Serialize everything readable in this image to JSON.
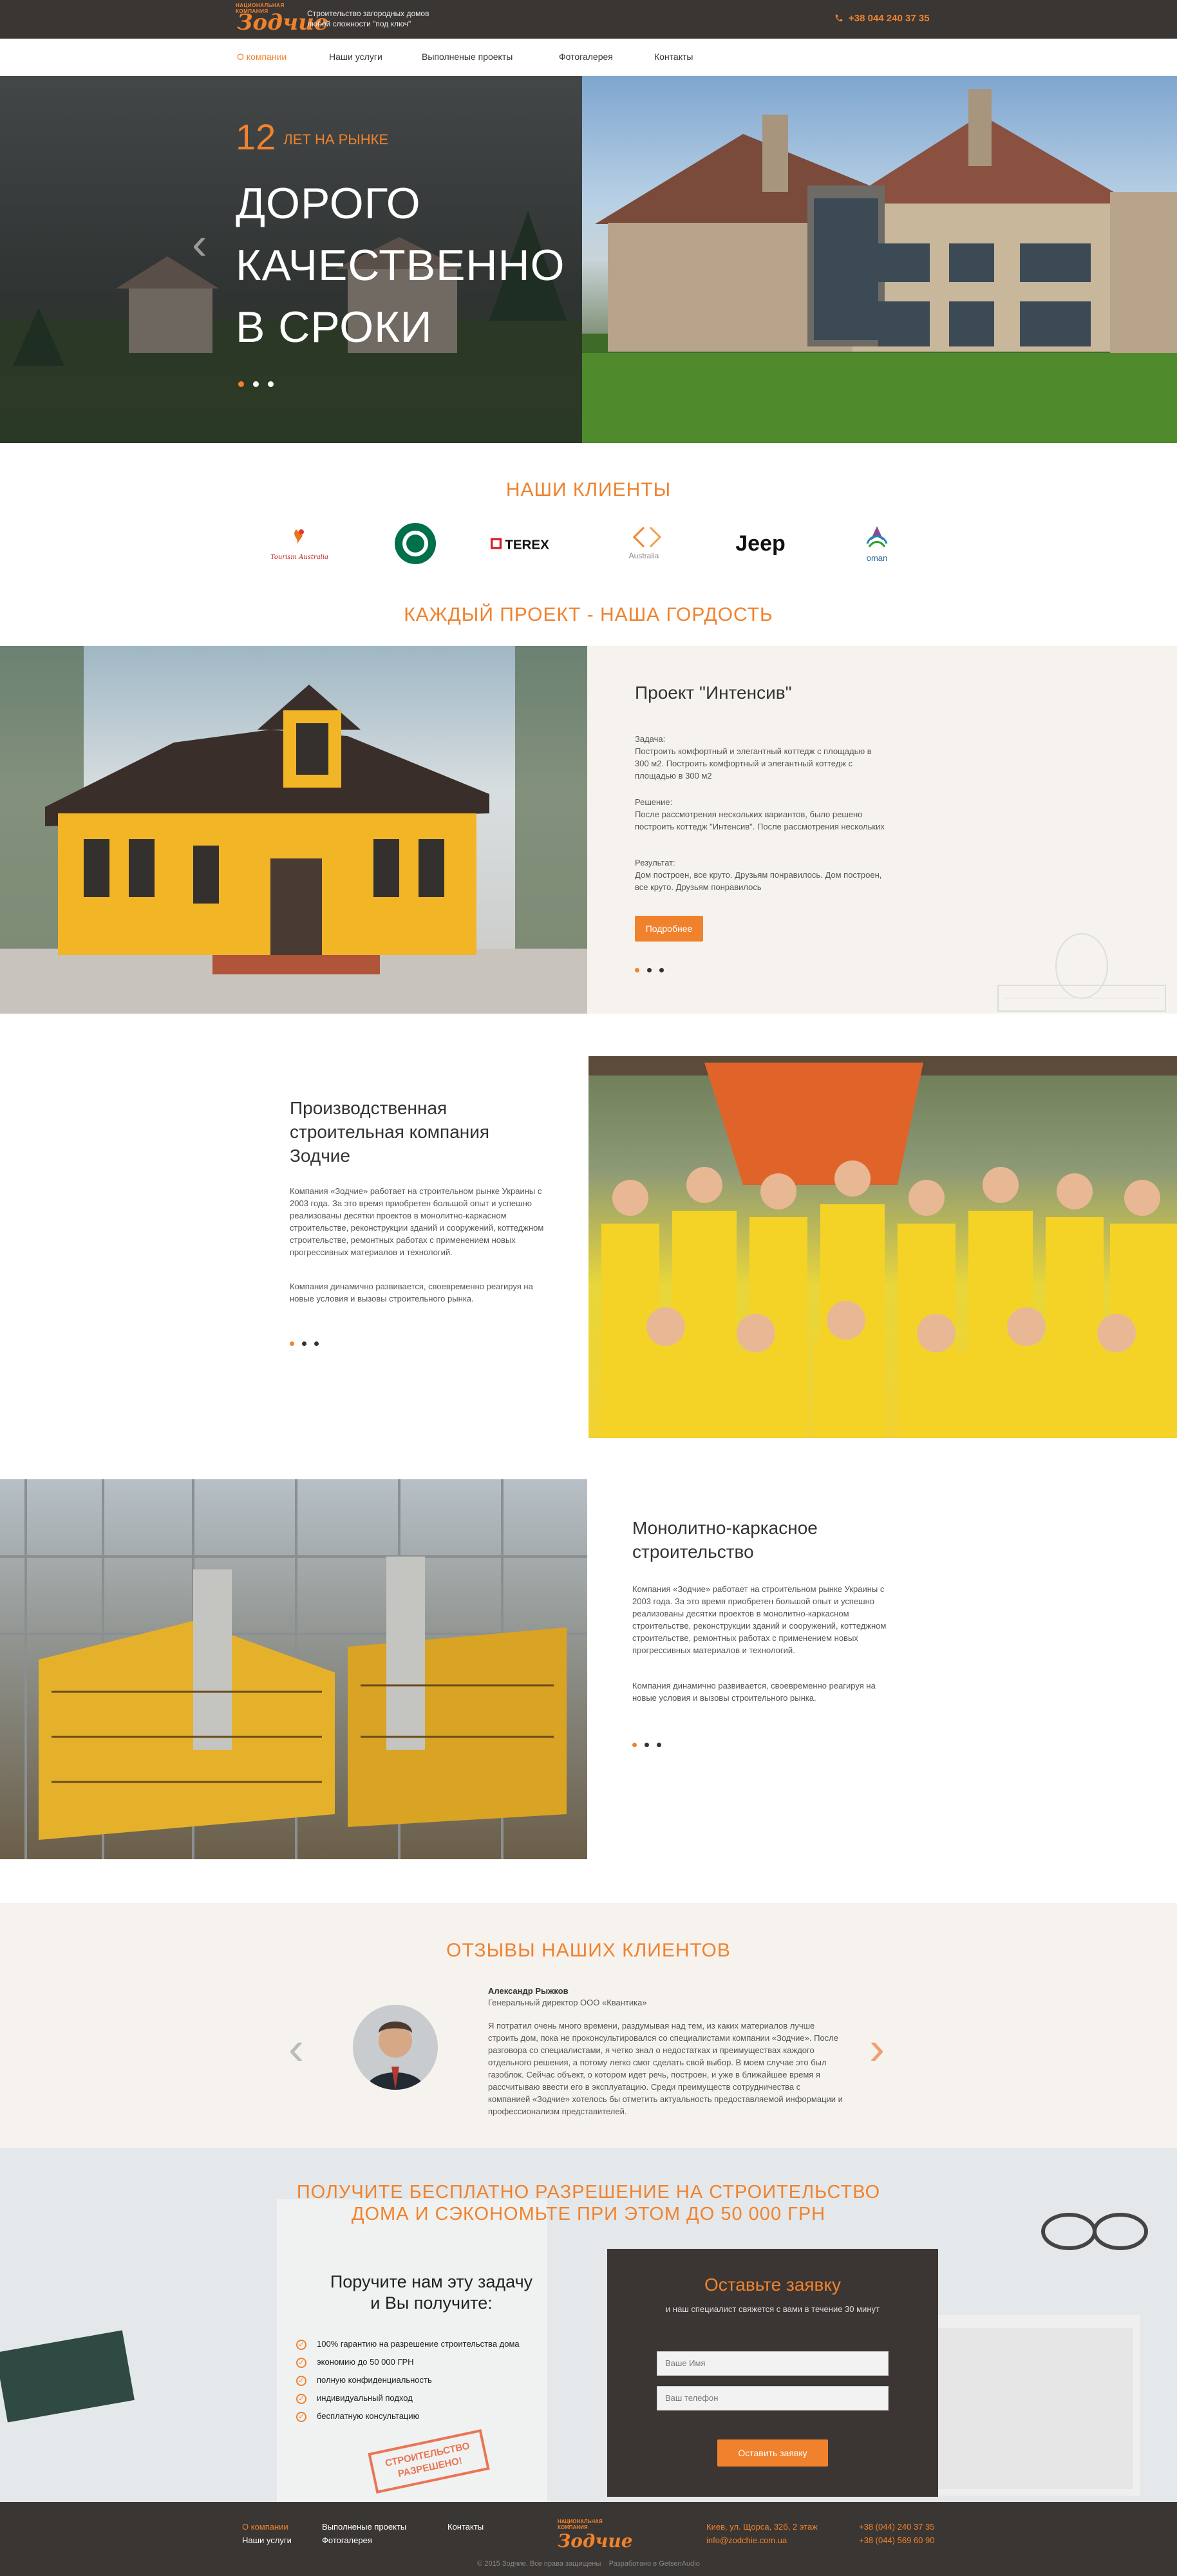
{
  "header": {
    "logo_kicker": "НАЦИОНАЛЬНАЯ КОМПАНИЯ",
    "logo_brand": "Зодчие",
    "tagline": "Строительство загородных домов любой сложности \"под ключ\"",
    "phone": "+38 044 240 37 35"
  },
  "nav": {
    "items": [
      "О компании",
      "Наши услуги",
      "Выполненые проекты",
      "Фотогалерея",
      "Контакты"
    ],
    "active_index": 0
  },
  "hero": {
    "years_number": "12",
    "years_text": "ЛЕТ НА РЫНКЕ",
    "headline_lines": [
      "ДОРОГО",
      "КАЧЕСТВЕННО",
      "В СРОКИ"
    ]
  },
  "clients": {
    "title": "НАШИ КЛИЕНТЫ",
    "logos": [
      "Tourism Australia",
      "Starbucks",
      "TEREX",
      "Australia",
      "Jeep",
      "oman"
    ]
  },
  "projects": {
    "title": "КАЖДЫЙ ПРОЕКТ - НАША ГОРДОСТЬ",
    "p1": {
      "heading": "Проект \"Интенсив\"",
      "task_label": "Задача:",
      "task_text": "Построить комфортный и элегантный коттедж с площадью в 300 м2. Построить комфортный и элегантный коттедж с площадью в 300 м2",
      "solution_label": "Решение:",
      "solution_text": "После рассмотрения нескольких вариантов, было решено построить коттедж \"Интенсив\". После рассмотрения нескольких",
      "result_label": "Результат:",
      "result_text": "Дом построен, все круто. Друзьям понравилось. Дом построен, все круто. Друзьям понравилось",
      "button": "Подробнее"
    },
    "p2": {
      "heading": "Производственная строительная компания Зодчие",
      "para1": "Компания «Зодчие» работает на строительном рынке Украины с 2003 года. За это время приобретен большой опыт и успешно реализованы десятки проектов в монолитно-каркасном строительстве, реконструкции зданий и сооружений, коттеджном строительстве, ремонтных работах с применением новых прогрессивных материалов и технологий.",
      "para2": "Компания динамично развивается, своевременно реагируя на новые условия и вызовы строительного рынка."
    },
    "p3": {
      "heading": "Монолитно-каркасное строительство",
      "para1": "Компания «Зодчие» работает на строительном рынке Украины с 2003 года. За это время приобретен большой опыт и успешно реализованы десятки проектов в монолитно-каркасном строительстве, реконструкции зданий и сооружений, коттеджном строительстве, ремонтных работах с применением новых прогрессивных материалов и технологий.",
      "para2": "Компания динамично развивается, своевременно реагируя на новые условия и вызовы строительного рынка."
    }
  },
  "reviews": {
    "title": "ОТЗЫВЫ НАШИХ КЛИЕНТОВ",
    "name": "Александр Рыжков",
    "position": "Генеральный директор ООО «Квантика»",
    "text": "Я потратил очень много времени, раздумывая над тем, из каких материалов лучше строить дом, пока не проконсультировался со специалистами компании «Зодчие». После разговора со специалистами, я четко знал о недостатках и преимуществах каждого отдельного решения, а потому легко смог сделать свой выбор. В моем случае это был газоблок. Сейчас объект, о котором идет речь, построен, и уже в ближайшее время я рассчитываю ввести его в эксплуатацию. Среди преимуществ сотрудничества с компанией «Зодчие» хотелось бы отметить актуальность предоставляемой информации и профессионализм представителей."
  },
  "cta": {
    "title_line1": "ПОЛУЧИТЕ БЕСПЛАТНО РАЗРЕШЕНИЕ НА СТРОИТЕЛЬСТВО",
    "title_line2": "ДОМА И СЭКОНОМЬТЕ ПРИ ЭТОМ ДО 50 000 ГРН",
    "subtitle_line1": "Поручите нам эту задачу",
    "subtitle_line2": "и Вы получите:",
    "benefits": [
      "100% гарантию на разрешение строительства дома",
      "экономию до 50 000 ГРН",
      "полную конфиденциальность",
      "индивидуальный подход",
      "бесплатную консультацию"
    ],
    "stamp": "СТРОИТЕЛЬСТВО РАЗРЕШЕНО!",
    "form_title": "Оставьте заявку",
    "form_subtitle": "и наш специалист свяжется с вами в течение 30 минут",
    "name_placeholder": "Ваше Имя",
    "phone_placeholder": "Ваш телефон",
    "submit": "Оставить заявку"
  },
  "footer": {
    "links_col1": [
      "О компании",
      "Наши услуги"
    ],
    "links_col2": [
      "Выполненые проекты",
      "Фотогалерея"
    ],
    "links_col3": [
      "Контакты"
    ],
    "address": "Киев, ул. Щорса, 32б, 2 этаж",
    "email": "info@zodchie.com.ua",
    "phone1": "+38 (044) 240 37 35",
    "phone2": "+38 (044) 569 60 90",
    "copyright": "© 2015 Зодчие. Все права защищены    Разработано в GetsenAudio"
  },
  "colors": {
    "accent": "#f0822e",
    "dark": "#3a3633",
    "light_bg": "#f6f3ef"
  }
}
